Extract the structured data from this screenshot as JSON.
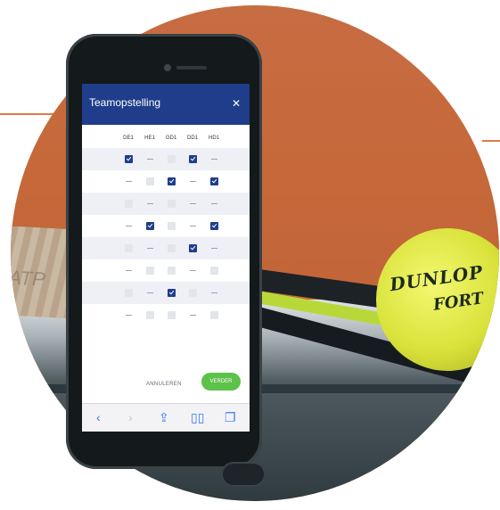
{
  "app": {
    "title": "Teamopstelling",
    "close_icon": "close-icon"
  },
  "columns": [
    "DE1",
    "HE1",
    "GD1",
    "DD1",
    "HD1"
  ],
  "grid": [
    [
      "checked",
      "dash",
      "empty",
      "checked",
      "dash"
    ],
    [
      "dash",
      "empty",
      "checked",
      "dash",
      "checked"
    ],
    [
      "empty",
      "dash",
      "empty",
      "dash",
      "dash"
    ],
    [
      "dash",
      "checked",
      "empty",
      "dash",
      "checked"
    ],
    [
      "empty",
      "dash",
      "empty",
      "checked",
      "dash"
    ],
    [
      "dash",
      "empty",
      "empty",
      "dash",
      "empty"
    ],
    [
      "empty",
      "dash",
      "checked",
      "empty",
      "dash"
    ],
    [
      "dash",
      "empty",
      "empty",
      "dash",
      "empty"
    ]
  ],
  "actions": {
    "cancel_label": "ANNULEREN",
    "next_label": "VERDER"
  },
  "browser_icons": [
    "back-icon",
    "forward-icon",
    "share-icon",
    "bookmarks-icon",
    "tabs-icon"
  ],
  "scene": {
    "ball_brand_line1": "DUNLOP",
    "ball_brand_line2": "FORT",
    "handle_text": "ATP"
  },
  "colors": {
    "header": "#1f3d8a",
    "accent_green": "#5cc24a",
    "wall": "#c76d43"
  }
}
